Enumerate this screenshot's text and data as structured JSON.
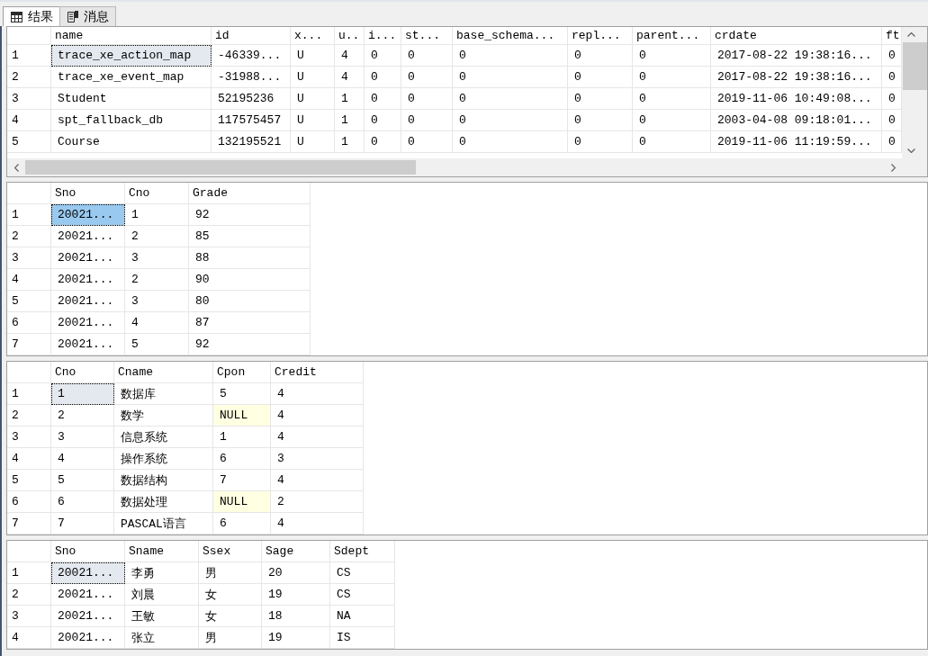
{
  "tabs": [
    {
      "kind": "results",
      "label": "结果",
      "selected": true
    },
    {
      "kind": "messages",
      "label": "消息",
      "selected": false
    }
  ],
  "grids": [
    {
      "focused": false,
      "scrollbars": true,
      "columns": [
        "name",
        "id",
        "x...",
        "u..",
        "i...",
        "st...",
        "base_schema...",
        "repl...",
        "parent...",
        "crdate",
        "ft"
      ],
      "rows": [
        {
          "number": "1",
          "cells": [
            {
              "text": "trace_xe_action_map",
              "selected": true,
              "null": false
            },
            {
              "text": "-46339...",
              "selected": false,
              "null": false
            },
            {
              "text": "U",
              "selected": false,
              "null": false
            },
            {
              "text": "4",
              "selected": false,
              "null": false
            },
            {
              "text": "0",
              "selected": false,
              "null": false
            },
            {
              "text": "0",
              "selected": false,
              "null": false
            },
            {
              "text": "0",
              "selected": false,
              "null": false
            },
            {
              "text": "0",
              "selected": false,
              "null": false
            },
            {
              "text": "0",
              "selected": false,
              "null": false
            },
            {
              "text": "2017-08-22 19:38:16...",
              "selected": false,
              "null": false
            },
            {
              "text": "0",
              "selected": false,
              "null": false
            }
          ]
        },
        {
          "number": "2",
          "cells": [
            {
              "text": "trace_xe_event_map",
              "selected": false,
              "null": false
            },
            {
              "text": "-31988...",
              "selected": false,
              "null": false
            },
            {
              "text": "U",
              "selected": false,
              "null": false
            },
            {
              "text": "4",
              "selected": false,
              "null": false
            },
            {
              "text": "0",
              "selected": false,
              "null": false
            },
            {
              "text": "0",
              "selected": false,
              "null": false
            },
            {
              "text": "0",
              "selected": false,
              "null": false
            },
            {
              "text": "0",
              "selected": false,
              "null": false
            },
            {
              "text": "0",
              "selected": false,
              "null": false
            },
            {
              "text": "2017-08-22 19:38:16...",
              "selected": false,
              "null": false
            },
            {
              "text": "0",
              "selected": false,
              "null": false
            }
          ]
        },
        {
          "number": "3",
          "cells": [
            {
              "text": "Student",
              "selected": false,
              "null": false
            },
            {
              "text": "52195236",
              "selected": false,
              "null": false
            },
            {
              "text": "U",
              "selected": false,
              "null": false
            },
            {
              "text": "1",
              "selected": false,
              "null": false
            },
            {
              "text": "0",
              "selected": false,
              "null": false
            },
            {
              "text": "0",
              "selected": false,
              "null": false
            },
            {
              "text": "0",
              "selected": false,
              "null": false
            },
            {
              "text": "0",
              "selected": false,
              "null": false
            },
            {
              "text": "0",
              "selected": false,
              "null": false
            },
            {
              "text": "2019-11-06 10:49:08...",
              "selected": false,
              "null": false
            },
            {
              "text": "0",
              "selected": false,
              "null": false
            }
          ]
        },
        {
          "number": "4",
          "cells": [
            {
              "text": "spt_fallback_db",
              "selected": false,
              "null": false
            },
            {
              "text": "117575457",
              "selected": false,
              "null": false
            },
            {
              "text": "U",
              "selected": false,
              "null": false
            },
            {
              "text": "1",
              "selected": false,
              "null": false
            },
            {
              "text": "0",
              "selected": false,
              "null": false
            },
            {
              "text": "0",
              "selected": false,
              "null": false
            },
            {
              "text": "0",
              "selected": false,
              "null": false
            },
            {
              "text": "0",
              "selected": false,
              "null": false
            },
            {
              "text": "0",
              "selected": false,
              "null": false
            },
            {
              "text": "2003-04-08 09:18:01...",
              "selected": false,
              "null": false
            },
            {
              "text": "0",
              "selected": false,
              "null": false
            }
          ]
        },
        {
          "number": "5",
          "cells": [
            {
              "text": "Course",
              "selected": false,
              "null": false
            },
            {
              "text": "132195521",
              "selected": false,
              "null": false
            },
            {
              "text": "U",
              "selected": false,
              "null": false
            },
            {
              "text": "1",
              "selected": false,
              "null": false
            },
            {
              "text": "0",
              "selected": false,
              "null": false
            },
            {
              "text": "0",
              "selected": false,
              "null": false
            },
            {
              "text": "0",
              "selected": false,
              "null": false
            },
            {
              "text": "0",
              "selected": false,
              "null": false
            },
            {
              "text": "0",
              "selected": false,
              "null": false
            },
            {
              "text": "2019-11-06 11:19:59...",
              "selected": false,
              "null": false
            },
            {
              "text": "0",
              "selected": false,
              "null": false
            }
          ]
        }
      ]
    },
    {
      "focused": true,
      "scrollbars": false,
      "columns": [
        "Sno",
        "Cno",
        "Grade"
      ],
      "rows": [
        {
          "number": "1",
          "cells": [
            {
              "text": "20021...",
              "selected": true,
              "null": false
            },
            {
              "text": "1",
              "selected": false,
              "null": false
            },
            {
              "text": "92",
              "selected": false,
              "null": false
            }
          ]
        },
        {
          "number": "2",
          "cells": [
            {
              "text": "20021...",
              "selected": false,
              "null": false
            },
            {
              "text": "2",
              "selected": false,
              "null": false
            },
            {
              "text": "85",
              "selected": false,
              "null": false
            }
          ]
        },
        {
          "number": "3",
          "cells": [
            {
              "text": "20021...",
              "selected": false,
              "null": false
            },
            {
              "text": "3",
              "selected": false,
              "null": false
            },
            {
              "text": "88",
              "selected": false,
              "null": false
            }
          ]
        },
        {
          "number": "4",
          "cells": [
            {
              "text": "20021...",
              "selected": false,
              "null": false
            },
            {
              "text": "2",
              "selected": false,
              "null": false
            },
            {
              "text": "90",
              "selected": false,
              "null": false
            }
          ]
        },
        {
          "number": "5",
          "cells": [
            {
              "text": "20021...",
              "selected": false,
              "null": false
            },
            {
              "text": "3",
              "selected": false,
              "null": false
            },
            {
              "text": "80",
              "selected": false,
              "null": false
            }
          ]
        },
        {
          "number": "6",
          "cells": [
            {
              "text": "20021...",
              "selected": false,
              "null": false
            },
            {
              "text": "4",
              "selected": false,
              "null": false
            },
            {
              "text": "87",
              "selected": false,
              "null": false
            }
          ]
        },
        {
          "number": "7",
          "cells": [
            {
              "text": "20021...",
              "selected": false,
              "null": false
            },
            {
              "text": "5",
              "selected": false,
              "null": false
            },
            {
              "text": "92",
              "selected": false,
              "null": false
            }
          ]
        }
      ]
    },
    {
      "focused": false,
      "scrollbars": false,
      "columns": [
        "Cno",
        "Cname",
        "Cpon",
        "Credit"
      ],
      "rows": [
        {
          "number": "1",
          "cells": [
            {
              "text": "1",
              "selected": true,
              "null": false
            },
            {
              "text": "数据库",
              "selected": false,
              "null": false
            },
            {
              "text": "5",
              "selected": false,
              "null": false
            },
            {
              "text": "4",
              "selected": false,
              "null": false
            }
          ]
        },
        {
          "number": "2",
          "cells": [
            {
              "text": "2",
              "selected": false,
              "null": false
            },
            {
              "text": "数学",
              "selected": false,
              "null": false
            },
            {
              "text": "NULL",
              "selected": false,
              "null": true
            },
            {
              "text": "4",
              "selected": false,
              "null": false
            }
          ]
        },
        {
          "number": "3",
          "cells": [
            {
              "text": "3",
              "selected": false,
              "null": false
            },
            {
              "text": "信息系统",
              "selected": false,
              "null": false
            },
            {
              "text": "1",
              "selected": false,
              "null": false
            },
            {
              "text": "4",
              "selected": false,
              "null": false
            }
          ]
        },
        {
          "number": "4",
          "cells": [
            {
              "text": "4",
              "selected": false,
              "null": false
            },
            {
              "text": "操作系统",
              "selected": false,
              "null": false
            },
            {
              "text": "6",
              "selected": false,
              "null": false
            },
            {
              "text": "3",
              "selected": false,
              "null": false
            }
          ]
        },
        {
          "number": "5",
          "cells": [
            {
              "text": "5",
              "selected": false,
              "null": false
            },
            {
              "text": "数据结构",
              "selected": false,
              "null": false
            },
            {
              "text": "7",
              "selected": false,
              "null": false
            },
            {
              "text": "4",
              "selected": false,
              "null": false
            }
          ]
        },
        {
          "number": "6",
          "cells": [
            {
              "text": "6",
              "selected": false,
              "null": false
            },
            {
              "text": "数据处理",
              "selected": false,
              "null": false
            },
            {
              "text": "NULL",
              "selected": false,
              "null": true
            },
            {
              "text": "2",
              "selected": false,
              "null": false
            }
          ]
        },
        {
          "number": "7",
          "cells": [
            {
              "text": "7",
              "selected": false,
              "null": false
            },
            {
              "text": "PASCAL语言",
              "selected": false,
              "null": false
            },
            {
              "text": "6",
              "selected": false,
              "null": false
            },
            {
              "text": "4",
              "selected": false,
              "null": false
            }
          ]
        }
      ]
    },
    {
      "focused": false,
      "scrollbars": false,
      "columns": [
        "Sno",
        "Sname",
        "Ssex",
        "Sage",
        "Sdept"
      ],
      "rows": [
        {
          "number": "1",
          "cells": [
            {
              "text": "20021...",
              "selected": true,
              "null": false
            },
            {
              "text": "李勇",
              "selected": false,
              "null": false
            },
            {
              "text": "男",
              "selected": false,
              "null": false
            },
            {
              "text": "20",
              "selected": false,
              "null": false
            },
            {
              "text": "CS",
              "selected": false,
              "null": false
            }
          ]
        },
        {
          "number": "2",
          "cells": [
            {
              "text": "20021...",
              "selected": false,
              "null": false
            },
            {
              "text": "刘晨",
              "selected": false,
              "null": false
            },
            {
              "text": "女",
              "selected": false,
              "null": false
            },
            {
              "text": "19",
              "selected": false,
              "null": false
            },
            {
              "text": "CS",
              "selected": false,
              "null": false
            }
          ]
        },
        {
          "number": "3",
          "cells": [
            {
              "text": "20021...",
              "selected": false,
              "null": false
            },
            {
              "text": "王敏",
              "selected": false,
              "null": false
            },
            {
              "text": "女",
              "selected": false,
              "null": false
            },
            {
              "text": "18",
              "selected": false,
              "null": false
            },
            {
              "text": "NA",
              "selected": false,
              "null": false
            }
          ]
        },
        {
          "number": "4",
          "cells": [
            {
              "text": "20021...",
              "selected": false,
              "null": false
            },
            {
              "text": "张立",
              "selected": false,
              "null": false
            },
            {
              "text": "男",
              "selected": false,
              "null": false
            },
            {
              "text": "19",
              "selected": false,
              "null": false
            },
            {
              "text": "IS",
              "selected": false,
              "null": false
            }
          ]
        }
      ]
    }
  ]
}
